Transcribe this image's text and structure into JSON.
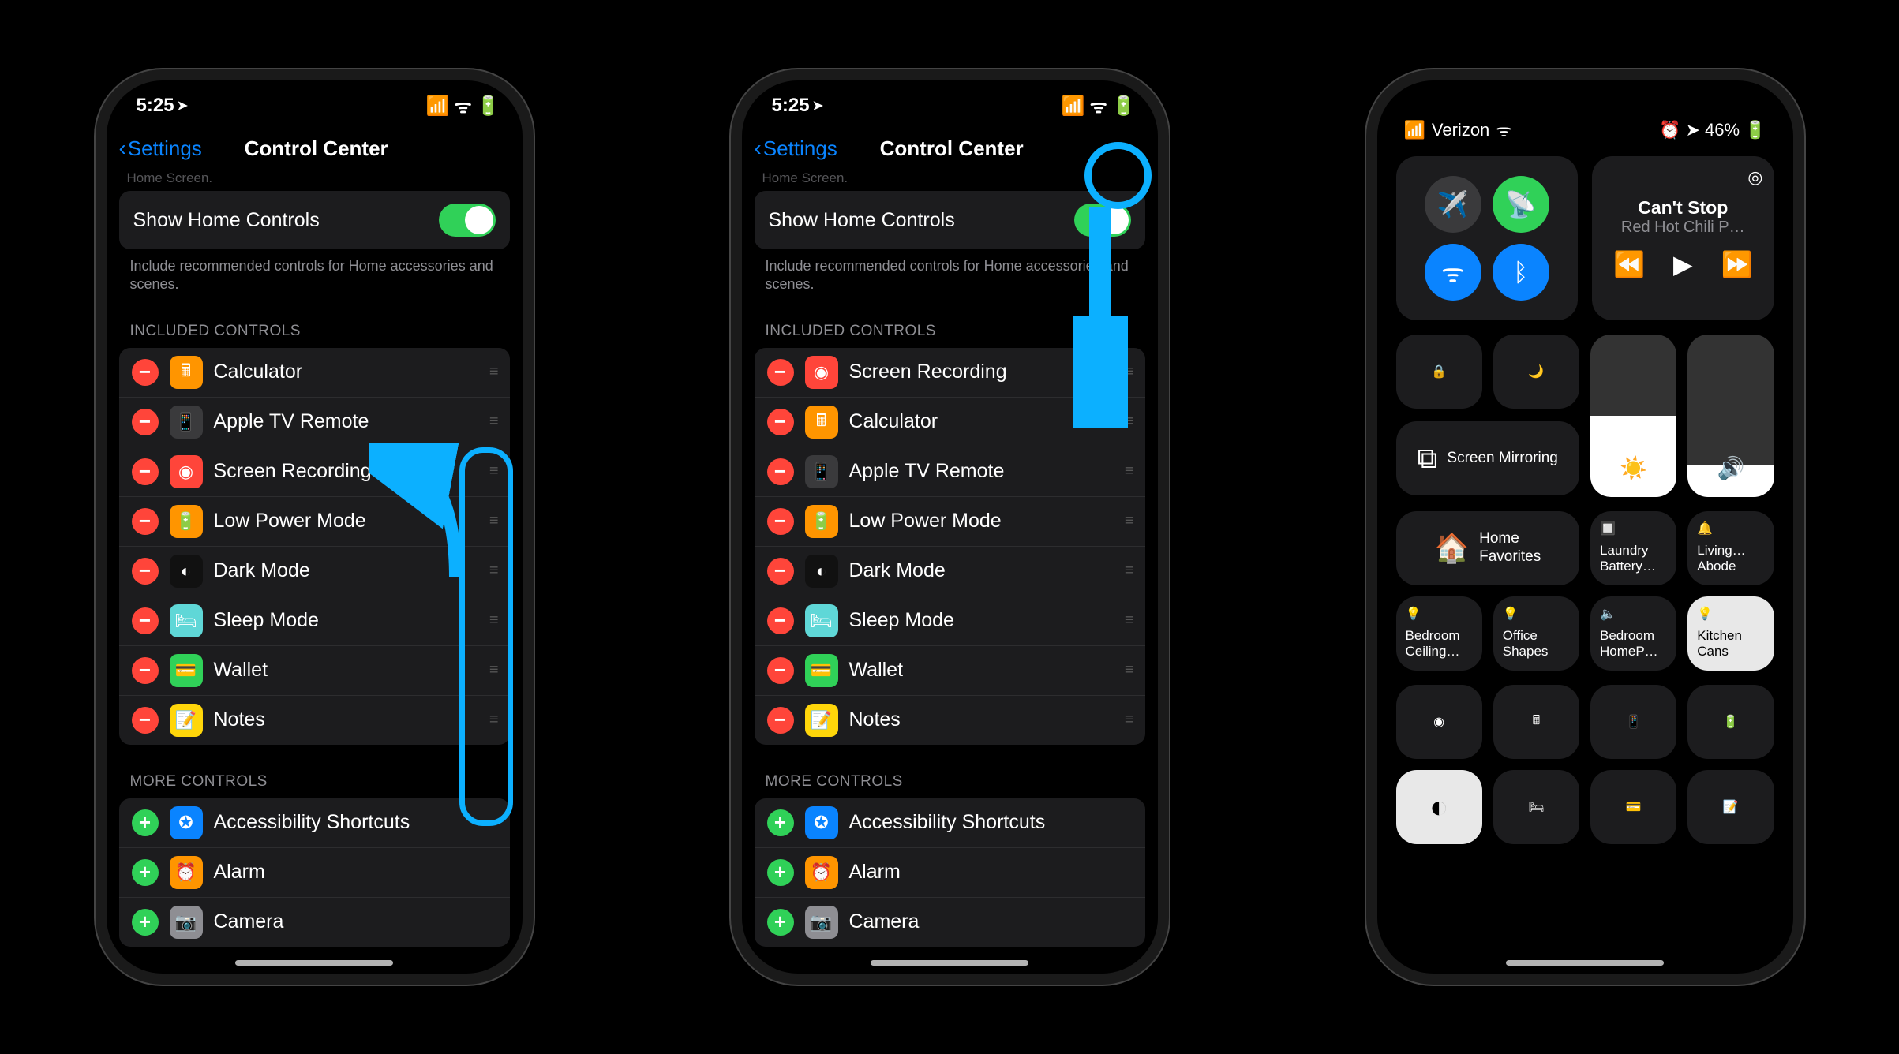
{
  "status": {
    "time": "5:25",
    "location_glyph": "➤"
  },
  "nav": {
    "back": "Settings",
    "title": "Control Center"
  },
  "truncated": "Home Screen.",
  "home_controls": {
    "label": "Show Home Controls",
    "note": "Include recommended controls for Home accessories and scenes."
  },
  "sections": {
    "included_a": "INCLUDED CONTROLS",
    "included_b": "INCLUDED CONTROLS",
    "more": "MORE CONTROLS"
  },
  "phone1_included": [
    {
      "label": "Calculator",
      "bg": "#ff9500",
      "glyph": "🖩"
    },
    {
      "label": "Apple TV Remote",
      "bg": "#3a3a3c",
      "glyph": "📱"
    },
    {
      "label": "Screen Recording",
      "bg": "#ff453a",
      "glyph": "◉"
    },
    {
      "label": "Low Power Mode",
      "bg": "#ff9500",
      "glyph": "🔋"
    },
    {
      "label": "Dark Mode",
      "bg": "#111",
      "glyph": "◐"
    },
    {
      "label": "Sleep Mode",
      "bg": "#5fd7d7",
      "glyph": "🛏"
    },
    {
      "label": "Wallet",
      "bg": "#30d158",
      "glyph": "💳"
    },
    {
      "label": "Notes",
      "bg": "#ffd60a",
      "glyph": "📝"
    }
  ],
  "phone2_included": [
    {
      "label": "Screen Recording",
      "bg": "#ff453a",
      "glyph": "◉"
    },
    {
      "label": "Calculator",
      "bg": "#ff9500",
      "glyph": "🖩"
    },
    {
      "label": "Apple TV Remote",
      "bg": "#3a3a3c",
      "glyph": "📱"
    },
    {
      "label": "Low Power Mode",
      "bg": "#ff9500",
      "glyph": "🔋"
    },
    {
      "label": "Dark Mode",
      "bg": "#111",
      "glyph": "◐"
    },
    {
      "label": "Sleep Mode",
      "bg": "#5fd7d7",
      "glyph": "🛏"
    },
    {
      "label": "Wallet",
      "bg": "#30d158",
      "glyph": "💳"
    },
    {
      "label": "Notes",
      "bg": "#ffd60a",
      "glyph": "📝"
    }
  ],
  "more": [
    {
      "label": "Accessibility Shortcuts",
      "bg": "#0a84ff",
      "glyph": "✪"
    },
    {
      "label": "Alarm",
      "bg": "#ff9500",
      "glyph": "⏰"
    },
    {
      "label": "Camera",
      "bg": "#8e8e93",
      "glyph": "📷"
    }
  ],
  "cc": {
    "carrier": "Verizon",
    "battery": "46%",
    "song": "Can't Stop",
    "artist": "Red Hot Chili P…",
    "screen_mirror": "Screen Mirroring",
    "home_label": "Home\nFavorites",
    "tiles": [
      {
        "l1": "Laundry",
        "l2": "Battery…"
      },
      {
        "l1": "Living…",
        "l2": "Abode"
      },
      {
        "l1": "Bedroom",
        "l2": "Ceiling…"
      },
      {
        "l1": "Office",
        "l2": "Shapes"
      },
      {
        "l1": "Bedroom",
        "l2": "HomeP…"
      },
      {
        "l1": "Kitchen",
        "l2": "Cans"
      }
    ]
  }
}
